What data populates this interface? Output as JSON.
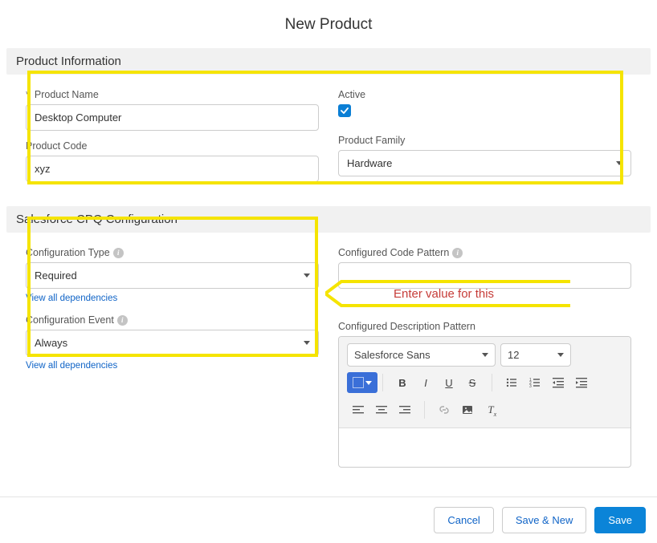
{
  "header": {
    "title": "New Product"
  },
  "sections": {
    "product_info": {
      "title": "Product Information",
      "product_name_label": "Product Name",
      "product_name_value": "Desktop Computer",
      "product_code_label": "Product Code",
      "product_code_value": "xyz",
      "active_label": "Active",
      "active_checked": true,
      "product_family_label": "Product Family",
      "product_family_value": "Hardware"
    },
    "cpq": {
      "title": "Salesforce CPQ Configuration",
      "config_type_label": "Configuration Type",
      "config_type_value": "Required",
      "config_event_label": "Configuration Event",
      "config_event_value": "Always",
      "view_deps": "View all dependencies",
      "code_pattern_label": "Configured Code Pattern",
      "code_pattern_value": "",
      "desc_pattern_label": "Configured Description Pattern",
      "rte_font": "Salesforce Sans",
      "rte_size": "12"
    }
  },
  "footer": {
    "cancel": "Cancel",
    "save_new": "Save & New",
    "save": "Save"
  },
  "annotation": {
    "text": "Enter value for this"
  }
}
